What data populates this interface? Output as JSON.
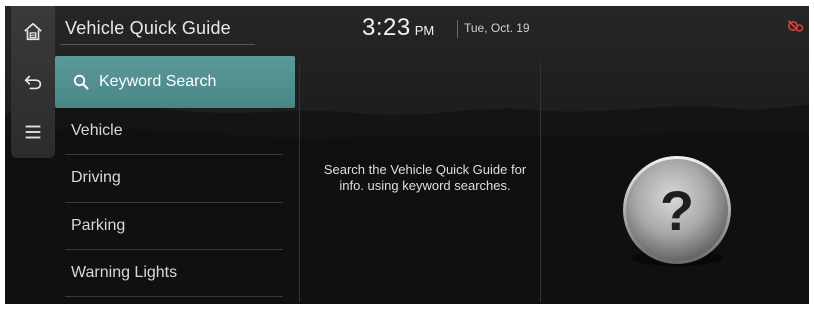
{
  "sidebar": {
    "buttons": [
      {
        "icon": "home-icon"
      },
      {
        "icon": "back-icon"
      },
      {
        "icon": "menu-icon"
      }
    ]
  },
  "header": {
    "title": "Vehicle Quick Guide",
    "time": "3:23",
    "ampm": "PM",
    "date": "Tue, Oct. 19",
    "status_icon": "connectivity-off-icon",
    "status_color": "#e0403a"
  },
  "menu": {
    "search_label": "Keyword Search",
    "items": [
      {
        "label": "Vehicle"
      },
      {
        "label": "Driving"
      },
      {
        "label": "Parking"
      },
      {
        "label": "Warning Lights"
      }
    ]
  },
  "content": {
    "info_line1": "Search the Vehicle Quick Guide for",
    "info_line2": "info. using keyword searches.",
    "help_icon": "question-mark-icon"
  },
  "colors": {
    "accent": "#4f8c8c",
    "background": "#1b1b1b"
  }
}
